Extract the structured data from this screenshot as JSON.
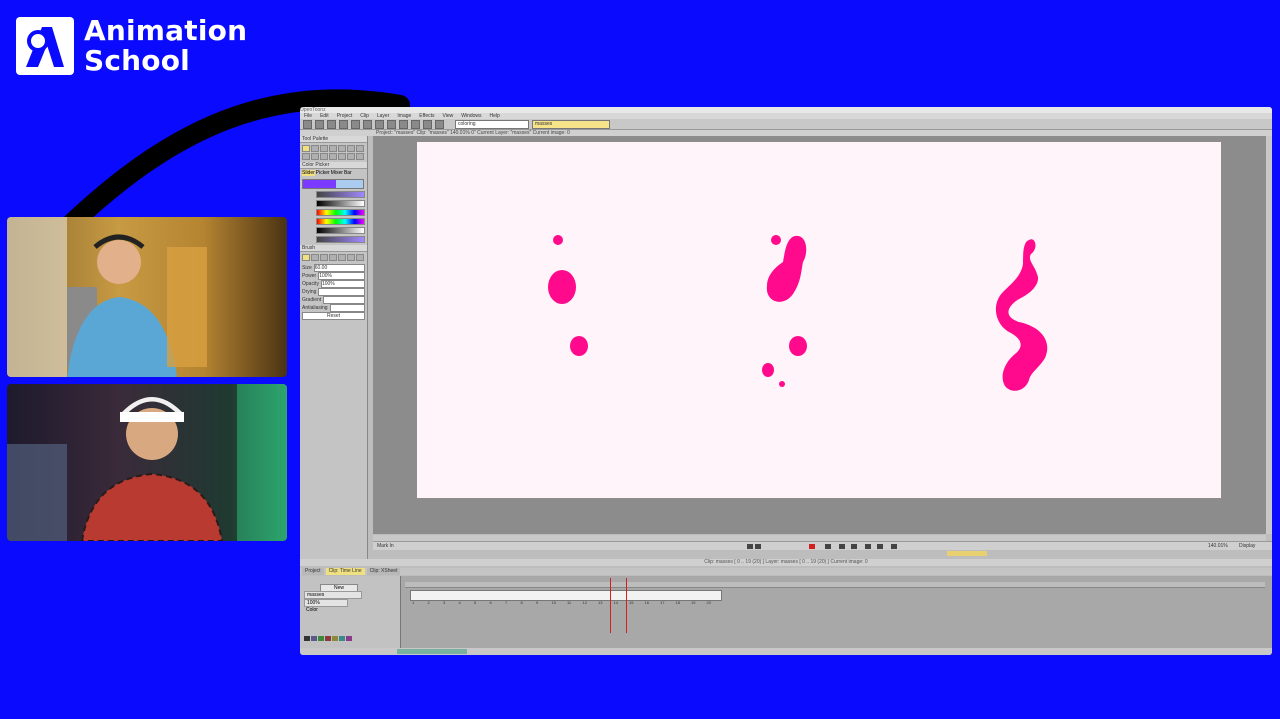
{
  "brand": {
    "name_line1": "Animation",
    "name_line2": "School"
  },
  "app": {
    "title": "OpenToonz",
    "menu": [
      "File",
      "Edit",
      "Project",
      "Clip",
      "Layer",
      "Image",
      "Effects",
      "View",
      "Windows",
      "Help"
    ],
    "toolbar": {
      "field1": "coloring",
      "field2": "masses"
    },
    "info": "Project: \"masses\"  Clip: \"masses\"  140.01%  0\"  Current Layer: \"masses\"  Current image: 0",
    "tool_panel_title": "Tool Palette",
    "color_picker_title": "Color Picker",
    "color_tabs": [
      "Slider",
      "Picker",
      "Mixer",
      "Bar"
    ],
    "slider_values": [
      "107",
      "86",
      "255",
      "255",
      "255",
      "112"
    ],
    "brush_panel_title": "Brush",
    "brush_props": [
      {
        "label": "Size",
        "value": "60.00"
      },
      {
        "label": "Power",
        "value": "100%"
      },
      {
        "label": "Opacity",
        "value": "100%"
      },
      {
        "label": "Drying",
        "value": ""
      },
      {
        "label": "Gradient",
        "value": ""
      },
      {
        "label": "Antialiasing",
        "value": ""
      }
    ],
    "reset_label": "Reset",
    "navigator_text": "Mark In",
    "zoom": "140.01%",
    "display_label": "Display",
    "status_text": "Clip: masses [ 0 .. 19 (20) ]     Layer: masses [ 0 .. 19 (20) ]     Current image: 0",
    "tabs": [
      "Project",
      "Clip: Time Line",
      "Clip: XSheet"
    ],
    "timeline": {
      "new_label": "New",
      "layer_name": "masses",
      "opacity": "100%",
      "color_label": "Color",
      "frames": [
        "1",
        "2",
        "3",
        "4",
        "5",
        "6",
        "7",
        "8",
        "9",
        "10",
        "11",
        "12",
        "13",
        "14",
        "15",
        "16",
        "17",
        "18",
        "19",
        "20"
      ]
    },
    "accent_colors": {
      "blob": "#ff0a8c",
      "canvas": "#fff4f9",
      "background": "#0a0aff"
    }
  }
}
